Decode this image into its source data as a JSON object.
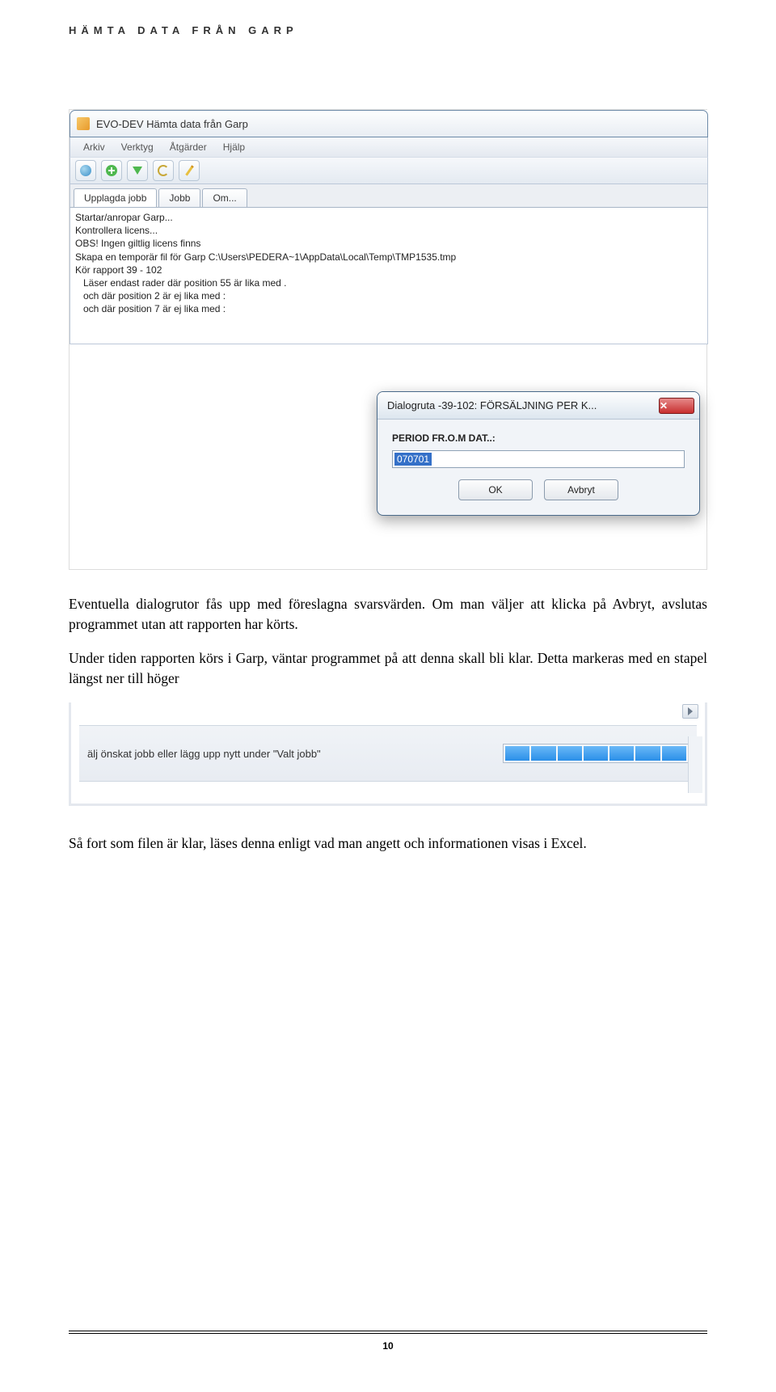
{
  "page": {
    "header": "HÄMTA DATA FRÅN GARP",
    "number": "10"
  },
  "mainwin": {
    "title": "EVO-DEV Hämta data från Garp",
    "menu": [
      "Arkiv",
      "Verktyg",
      "Åtgärder",
      "Hjälp"
    ],
    "tabs": [
      "Upplagda jobb",
      "Jobb",
      "Om..."
    ],
    "log": [
      "Startar/anropar Garp...",
      "Kontrollera licens...",
      "OBS! Ingen giltlig licens finns",
      "Skapa en temporär fil för Garp C:\\Users\\PEDERA~1\\AppData\\Local\\Temp\\TMP1535.tmp",
      "Kör rapport 39 - 102",
      "Läser endast rader där position 55 är lika med .",
      "och där position 2 är ej lika med :",
      "och där position 7 är ej lika med :"
    ]
  },
  "dialog": {
    "title": "Dialogruta -39-102: FÖRSÄLJNING PER K...",
    "label": "PERIOD FR.O.M DAT..:",
    "value": "070701",
    "ok": "OK",
    "cancel": "Avbryt"
  },
  "para1a": "Eventuella dialogrutor fås upp med föreslagna svarsvärden. Om man väljer att klicka på Avbryt, avslutas programmet utan att rapporten har körts.",
  "para1b": "Under tiden rapporten körs i Garp, väntar programmet på att denna skall bli klar. Detta markeras med en stapel längst ner till höger",
  "statusbar": {
    "text": "älj önskat jobb eller lägg upp nytt under \"Valt jobb\""
  },
  "para2": "Så fort som filen är klar, läses denna enligt vad man angett och informationen visas i Excel."
}
